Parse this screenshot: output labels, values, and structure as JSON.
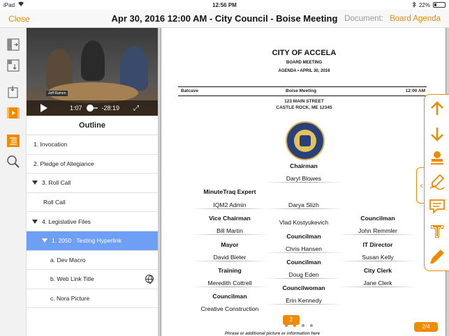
{
  "status_bar": {
    "carrier": "iPad",
    "time": "12:56 PM",
    "battery": "22%"
  },
  "nav": {
    "close": "Close",
    "title": "Apr 30, 2016 12:00 AM - City Council - Boise Meeting",
    "document_label": "Document:",
    "document_value": "Board Agenda"
  },
  "video": {
    "current": "1:07",
    "remaining": "-28:19",
    "caption": "Jeff Ramon"
  },
  "outline": {
    "heading": "Outline",
    "items": [
      {
        "label": "1. Invocation"
      },
      {
        "label": "2. Pledge of Allegiance"
      },
      {
        "label": "3. Roll Call"
      },
      {
        "label": "Roll Call"
      },
      {
        "label": "4. Legislative Files"
      },
      {
        "label": "1. 2050 : Testing Hyperlink"
      },
      {
        "label": "a. Dev Macro"
      },
      {
        "label": "b. Web Link Title"
      },
      {
        "label": "c. Nora Picture"
      }
    ]
  },
  "document": {
    "org": "CITY OF ACCELA",
    "meeting": "BOARD MEETING",
    "agenda": "AGENDA • APRIL 30, 2016",
    "row_left": "Batcave",
    "row_center": "Boise Meeting",
    "row_right": "12:00 AM",
    "address1": "123 MAIN STREET",
    "address2": "CASTLE ROCK, ME  12345",
    "members": [
      {
        "role": "Chairman",
        "name": "Daryl Blowes"
      },
      {
        "role": "MinuteTraq Expert",
        "name": "IQM2 Admin"
      },
      {
        "role": "",
        "name": "Darya Slizh"
      },
      {
        "role": "Vice Chairman",
        "name": "Bill Martin"
      },
      {
        "role": "",
        "name": "Vlad Kostyukevich"
      },
      {
        "role": "Councilman",
        "name": "John Remmler"
      },
      {
        "role": "Councilman",
        "name": "Chris Hansen"
      },
      {
        "role": "Mayor",
        "name": "David Bieter"
      },
      {
        "role": "IT Director",
        "name": "Susan Kelly"
      },
      {
        "role": "Councilman",
        "name": "Doug Eden"
      },
      {
        "role": "Training",
        "name": "Meredith Cottrell"
      },
      {
        "role": "City Clerk",
        "name": "Jane Clerk"
      },
      {
        "role": "Councilwoman",
        "name": "Erin Kennedy"
      },
      {
        "role": "Councilman",
        "name": "Creative Construction"
      }
    ],
    "footer_note": "Phrase or additional picture or information here",
    "slide_badge": "2",
    "page_count": "2/4"
  },
  "colors": {
    "accent": "#f08a00",
    "selection": "#6f9ff5"
  }
}
